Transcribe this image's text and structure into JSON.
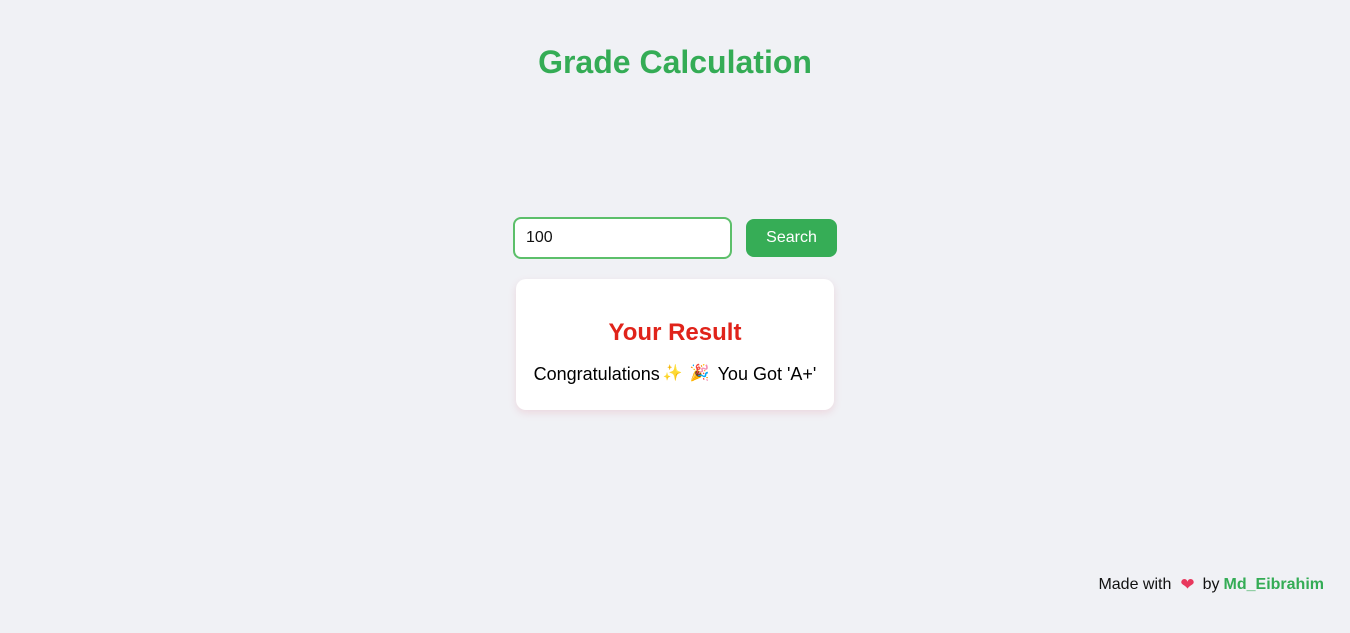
{
  "header": {
    "title": "Grade Calculation"
  },
  "search": {
    "value": "100",
    "button_label": "Search"
  },
  "result": {
    "title": "Your Result",
    "message_prefix": "Congratulations",
    "sparkles_emoji": "✨",
    "party_emoji": "🎉",
    "message_suffix": "You Got 'A+'"
  },
  "footer": {
    "made_with": "Made with",
    "heart_icon": "❤",
    "by": "by",
    "author": "Md_Eibrahim"
  },
  "colors": {
    "title_green": "#34ac55",
    "button_green": "#36ad56",
    "result_red": "#e0231a",
    "background": "#f0f1f5"
  }
}
